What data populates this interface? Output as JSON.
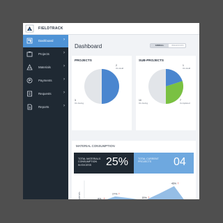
{
  "app": {
    "name": "FIELDTRACK"
  },
  "sidebar": {
    "items": [
      {
        "label": "Dashboard",
        "icon": "dashboard-icon",
        "active": true
      },
      {
        "label": "Projects",
        "icon": "projects-icon",
        "active": false
      },
      {
        "label": "Materials",
        "icon": "materials-icon",
        "active": false
      },
      {
        "label": "Payments",
        "icon": "payments-icon",
        "active": false
      },
      {
        "label": "Requests",
        "icon": "requests-icon",
        "active": false
      },
      {
        "label": "Reports",
        "icon": "reports-icon",
        "active": false
      }
    ]
  },
  "dashboard": {
    "title": "Dashboard",
    "toggle": {
      "option1": "OVERALL",
      "option2": "BREAKDOWN"
    }
  },
  "projects_card": {
    "title": "PROJECTS",
    "on_going": {
      "value": "3",
      "label": "On-Going"
    },
    "on_hold": {
      "value": "2",
      "label": "On-Hold"
    }
  },
  "subprojects_card": {
    "title": "SUB-PROJECTS",
    "on_hold": {
      "value": "1",
      "label": "On-Hold"
    },
    "on_going": {
      "value": "10",
      "label": "On-Going"
    },
    "completed": {
      "value": "7",
      "label": "Completed"
    }
  },
  "material": {
    "title": "MATERIAL CONSUMPTION",
    "excess": {
      "label_line1": "TOTAL MATERIALS",
      "label_line2": "CONSUMPTION",
      "label_line3": "IN EXCESS",
      "value": "25%"
    },
    "current": {
      "label_line1": "TOTAL CURRENT",
      "label_line2": "PROJECTS",
      "value": "04"
    }
  },
  "colors": {
    "accent": "#4f93d6",
    "sidebar_bg": "#1f2933",
    "pie_grey": "#e2e5e9",
    "pie_blue": "#4a86cf",
    "pie_green": "#7ac142",
    "chart_area": "#b8cfe6",
    "chart_line": "#4f93d6",
    "alert_red": "#e04848"
  },
  "chart_data": {
    "type": "area",
    "ylabel": "Materials",
    "point_labels": [
      "8%",
      "27%",
      "20%",
      "45%"
    ],
    "series": [
      {
        "values": [
          2,
          4,
          6,
          8,
          10,
          12,
          10,
          7
        ]
      },
      {
        "values": [
          8,
          18,
          27,
          24,
          20,
          32,
          45,
          10
        ]
      }
    ]
  }
}
